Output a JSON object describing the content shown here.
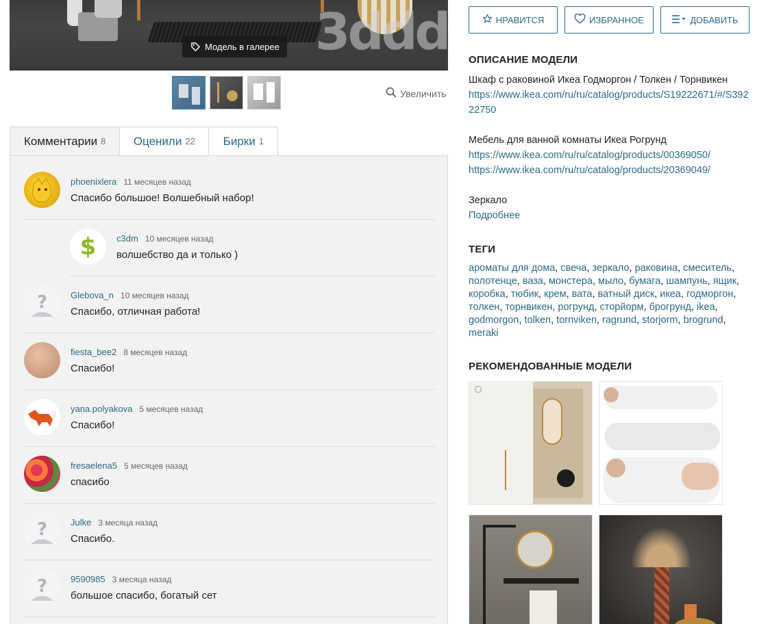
{
  "gallery": {
    "badge_label": "Модель в галерее",
    "logo_text": "3ddd",
    "zoom_label": "Увеличить"
  },
  "tabs": [
    {
      "label": "Комментарии",
      "count": "8"
    },
    {
      "label": "Оценили",
      "count": "22"
    },
    {
      "label": "Бирки",
      "count": "1"
    }
  ],
  "comments": [
    {
      "user": "phoenixlera",
      "time": "11 месяцев назад",
      "text": "Спасибо большое! Волшебный набор!"
    },
    {
      "user": "c3dm",
      "time": "10 месяцев назад",
      "text": "волшебство да и только )"
    },
    {
      "user": "Glebova_n",
      "time": "10 месяцев назад",
      "text": "Спасибо, отличная работа!"
    },
    {
      "user": "fiesta_bee2",
      "time": "8 месяцев назад",
      "text": "Спасибо!"
    },
    {
      "user": "yana.polyakova",
      "time": "5 месяцев назад",
      "text": "Спасибо!"
    },
    {
      "user": "fresaelena5",
      "time": "5 месяцев назад",
      "text": "спасибо"
    },
    {
      "user": "Julke",
      "time": "3 месяца назад",
      "text": "Спасибо."
    },
    {
      "user": "9590985",
      "time": "3 месяца назад",
      "text": "большое спасибо, богатый сет"
    }
  ],
  "actions": {
    "like": "НРАВИТСЯ",
    "favorite": "ИЗБРАННОЕ",
    "add": "ДОБАВИТЬ"
  },
  "description": {
    "heading": "ОПИСАНИЕ МОДЕЛИ",
    "line1": "Шкаф с раковиной Икеа Годморгон / Толкен / Торнвикен",
    "link1": "https://www.ikea.com/ru/ru/catalog/products/S19222671/#/S39222750",
    "line2": "Мебель для ванной комнаты Икеа Рогрунд",
    "link2": "https://www.ikea.com/ru/ru/catalog/products/00369050/",
    "link3": "https://www.ikea.com/ru/ru/catalog/products/20369049/",
    "line3": "Зеркало",
    "more": "Подробнее"
  },
  "tags": {
    "heading": "ТЕГИ",
    "items": [
      "ароматы для дома",
      "свеча",
      "зеркало",
      "раковина",
      "смеситель",
      "полотенце",
      "ваза",
      "монстера",
      "мыло",
      "бумага",
      "шампунь",
      "ящик",
      "коробка",
      "тюбик",
      "крем",
      "вата",
      "ватный диск",
      "икеа",
      "годморгон",
      "толкен",
      "торнвикен",
      "рогрунд",
      "сторйорм",
      "брогрунд",
      "ikea",
      "godmorgon",
      "tolken",
      "tornviken",
      "ragrund",
      "storjorm",
      "brogrund",
      "meraki"
    ]
  },
  "recommended": {
    "heading": "РЕКОМЕНДОВАННЫЕ МОДЕЛИ"
  },
  "colors": {
    "link": "#2a6a86",
    "comments_bg": "#f2f2f2"
  }
}
